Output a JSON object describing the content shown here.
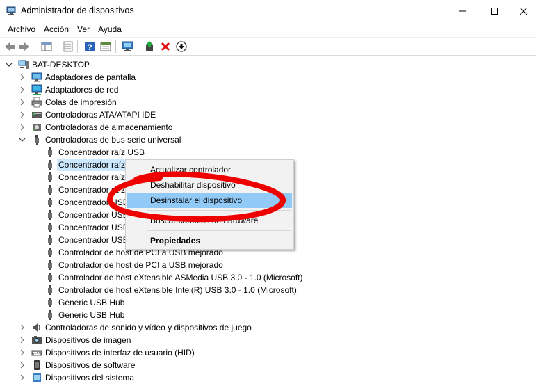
{
  "window": {
    "title": "Administrador de dispositivos",
    "minimize_glyph": "—",
    "maximize_glyph": "☐",
    "close_glyph": "✕"
  },
  "menubar": {
    "items": [
      "Archivo",
      "Acción",
      "Ver",
      "Ayuda"
    ]
  },
  "toolbar": {
    "buttons": [
      "back-icon",
      "forward-icon",
      "properties-view-icon",
      "show-hide-tree-icon",
      "help-icon",
      "details-view-icon",
      "scan-hardware-icon",
      "update-driver-icon",
      "uninstall-icon",
      "enable-device-icon"
    ]
  },
  "tree": {
    "root": "BAT-DESKTOP",
    "categories_top": [
      "Adaptadores de pantalla",
      "Adaptadores de red",
      "Colas de impresión",
      "Controladoras ATA/ATAPI IDE",
      "Controladoras de almacenamiento",
      "Controladoras de bus serie universal"
    ],
    "usb_children": [
      "Concentrador raíz USB",
      "Concentrador raíz USB",
      "Concentrador raíz USB",
      "Concentrador raíz USB",
      "Concentrador USB",
      "Concentrador USB",
      "Concentrador USB",
      "Concentrador USB",
      "Controlador de host de PCI a USB mejorado",
      "Controlador de host de PCI a USB mejorado",
      "Controlador de host eXtensible ASMedia USB 3.0 - 1.0 (Microsoft)",
      "Controlador de host eXtensible Intel(R) USB 3.0 - 1.0 (Microsoft)",
      "Generic USB Hub",
      "Generic USB Hub"
    ],
    "categories_bottom": [
      "Controladoras de sonido y vídeo y dispositivos de juego",
      "Dispositivos de imagen",
      "Dispositivos de interfaz de usuario (HID)",
      "Dispositivos de software",
      "Dispositivos del sistema"
    ]
  },
  "context_menu": {
    "update": "Actualizar controlador",
    "disable": "Deshabilitar dispositivo",
    "uninstall": "Desinstalar el dispositivo",
    "scan": "Buscar cambios de hardware",
    "properties": "Propiedades"
  },
  "colors": {
    "selection": "#cce8ff",
    "menu_highlight": "#91c9f7",
    "annotation": "#ee0000"
  }
}
